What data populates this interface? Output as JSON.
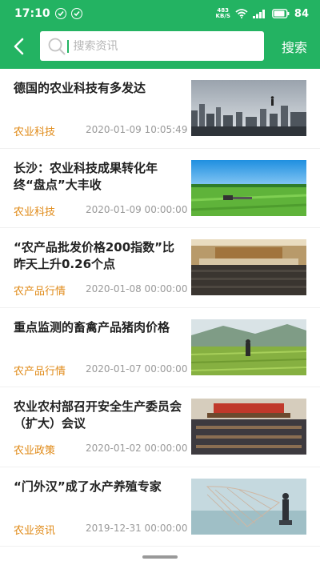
{
  "status_bar": {
    "time": "17:10",
    "net_speed_value": "483",
    "net_speed_unit": "KB/S",
    "battery": "84"
  },
  "header": {
    "search_placeholder": "搜索资讯",
    "search_button": "搜索"
  },
  "news": [
    {
      "title": "德国的农业科技有多发达",
      "tag": "农业科技",
      "date": "2020-01-09 10:05:49",
      "thumb": "city-skyline-photo"
    },
    {
      "title": "长沙：农业科技成果转化年终“盘点”大丰收",
      "tag": "农业科技",
      "date": "2020-01-09 00:00:00",
      "thumb": "green-field-tractor-photo"
    },
    {
      "title": "“农产品批发价格200指数”比昨天上升0.26个点",
      "tag": "农产品行情",
      "date": "2020-01-08 00:00:00",
      "thumb": "conference-hall-photo"
    },
    {
      "title": "重点监测的畜禽产品猪肉价格",
      "tag": "农产品行情",
      "date": "2020-01-07 00:00:00",
      "thumb": "rice-terrace-farmer-photo"
    },
    {
      "title": "农业农村部召开安全生产委员会（扩大）会议",
      "tag": "农业政策",
      "date": "2020-01-02 00:00:00",
      "thumb": "meeting-room-photo"
    },
    {
      "title": "“门外汉”成了水产养殖专家",
      "tag": "农业资讯",
      "date": "2019-12-31 00:00:00",
      "thumb": "fishing-net-photo"
    }
  ],
  "colors": {
    "brand": "#23b362",
    "tag": "#e08a17",
    "date": "#9a9a9a"
  }
}
